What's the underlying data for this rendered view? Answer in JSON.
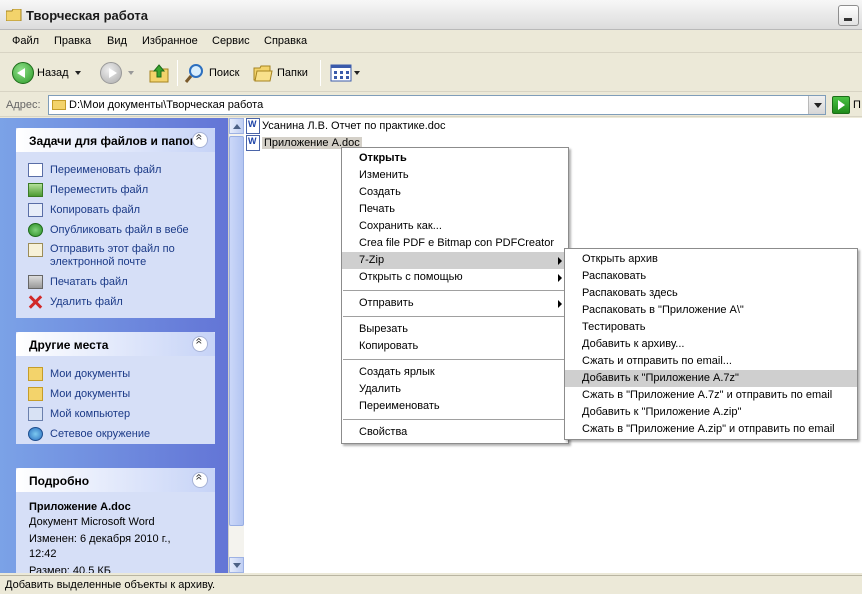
{
  "window": {
    "title": "Творческая работа"
  },
  "menubar": {
    "items": [
      "Файл",
      "Правка",
      "Вид",
      "Избранное",
      "Сервис",
      "Справка"
    ]
  },
  "toolbar": {
    "back": "Назад",
    "search": "Поиск",
    "folders": "Папки"
  },
  "address": {
    "label": "Адрес:",
    "path": "D:\\Мои документы\\Творческая работа",
    "go": "П"
  },
  "tasks": {
    "title": "Задачи для файлов и папок",
    "items": [
      "Переименовать файл",
      "Переместить файл",
      "Копировать файл",
      "Опубликовать файл в вебе",
      "Отправить этот файл по электронной почте",
      "Печатать файл",
      "Удалить файл"
    ]
  },
  "places": {
    "title": "Другие места",
    "items": [
      "Мои документы",
      "Мои документы",
      "Мой компьютер",
      "Сетевое окружение"
    ]
  },
  "details": {
    "title": "Подробно",
    "name": "Приложение А.doc",
    "type": "Документ Microsoft Word",
    "modified_1": "Изменен: 6 декабря 2010 г.,",
    "modified_2": "12:42",
    "size": "Размер: 40,5 КБ"
  },
  "files": [
    "Усанина Л.В. Отчет по практике.doc",
    "Приложение А.doc"
  ],
  "context_menu": {
    "items": [
      "Открыть",
      "Изменить",
      "Создать",
      "Печать",
      "Сохранить как...",
      "Crea file PDF e Bitmap con PDFCreator",
      "7-Zip",
      "Открыть с помощью",
      "Отправить",
      "Вырезать",
      "Копировать",
      "Создать ярлык",
      "Удалить",
      "Переименовать",
      "Свойства"
    ]
  },
  "zip_menu": {
    "items": [
      "Открыть архив",
      "Распаковать",
      "Распаковать здесь",
      "Распаковать в \"Приложение А\\\"",
      "Тестировать",
      "Добавить к архиву...",
      "Сжать и отправить по email...",
      "Добавить к \"Приложение А.7z\"",
      "Сжать в \"Приложение А.7z\" и отправить по email",
      "Добавить к \"Приложение А.zip\"",
      "Сжать в \"Приложение А.zip\" и отправить по email"
    ]
  },
  "status": {
    "text": "Добавить выделенные объекты к архиву."
  }
}
